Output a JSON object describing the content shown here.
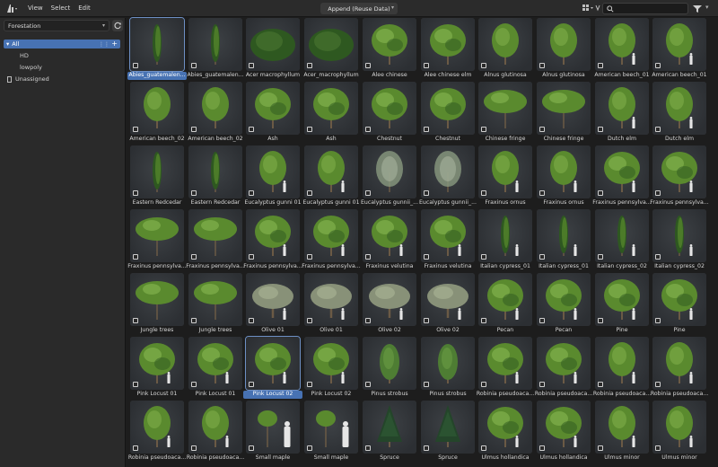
{
  "header": {
    "menus": [
      "View",
      "Select",
      "Edit"
    ],
    "import_method": "Append (Reuse Data)"
  },
  "sidebar": {
    "library": "Forestation",
    "categories": {
      "all": "All",
      "children": [
        "HD",
        "lowpoly"
      ],
      "unassigned": "Unassigned"
    }
  },
  "colors": {
    "accent": "#4772b3",
    "tile_bg": "#2f3235",
    "foliage": "#5a8a2e",
    "foliage_dark": "#2e5820"
  },
  "assets": [
    {
      "name": "Abies_guatemalen...",
      "shape": "columnar",
      "selected": true
    },
    {
      "name": "Abies_guatemalen...",
      "shape": "columnar"
    },
    {
      "name": "Acer macrophyllum",
      "shape": "bush"
    },
    {
      "name": "Acer_macrophyllum",
      "shape": "bush"
    },
    {
      "name": "Alee chinese",
      "shape": "round"
    },
    {
      "name": "Alee chinese elm",
      "shape": "round"
    },
    {
      "name": "Alnus glutinosa",
      "shape": "oval"
    },
    {
      "name": "Alnus glutinosa",
      "shape": "oval"
    },
    {
      "name": "American beech_01",
      "shape": "oval",
      "person": true
    },
    {
      "name": "American beech_01",
      "shape": "oval",
      "person": true
    },
    {
      "name": "American beech_02",
      "shape": "oval"
    },
    {
      "name": "American beech_02",
      "shape": "oval"
    },
    {
      "name": "Ash",
      "shape": "round"
    },
    {
      "name": "Ash",
      "shape": "round"
    },
    {
      "name": "Chestnut",
      "shape": "round"
    },
    {
      "name": "Chestnut",
      "shape": "round"
    },
    {
      "name": "Chinese fringe",
      "shape": "spread"
    },
    {
      "name": "Chinese fringe",
      "shape": "spread"
    },
    {
      "name": "Dutch elm",
      "shape": "oval",
      "person": true
    },
    {
      "name": "Dutch elm",
      "shape": "oval",
      "person": true
    },
    {
      "name": "Eastern Redcedar",
      "shape": "columnar"
    },
    {
      "name": "Eastern Redcedar",
      "shape": "columnar"
    },
    {
      "name": "Eucalyptus gunni 01",
      "shape": "oval",
      "person": true
    },
    {
      "name": "Eucalyptus gunni 01",
      "shape": "oval",
      "person": true
    },
    {
      "name": "Eucalyptus gunnii_...",
      "shape": "sparse"
    },
    {
      "name": "Eucalyptus gunnii_...",
      "shape": "sparse"
    },
    {
      "name": "Fraxinus ornus",
      "shape": "oval",
      "person": true
    },
    {
      "name": "Fraxinus ornus",
      "shape": "oval",
      "person": true
    },
    {
      "name": "Fraxinus pennsylva...",
      "shape": "round",
      "person": true
    },
    {
      "name": "Fraxinus pennsylva...",
      "shape": "round",
      "person": true
    },
    {
      "name": "Fraxinus pennsylva...",
      "shape": "spread"
    },
    {
      "name": "Fraxinus pennsylva...",
      "shape": "spread"
    },
    {
      "name": "Fraxinus pennsylva...",
      "shape": "round",
      "person": true
    },
    {
      "name": "Fraxinus pennsylva...",
      "shape": "round",
      "person": true
    },
    {
      "name": "Fraxinus velutina",
      "shape": "round",
      "person": true
    },
    {
      "name": "Fraxinus velutina",
      "shape": "round",
      "person": true
    },
    {
      "name": "Italian cypress_01",
      "shape": "columnar",
      "person": true
    },
    {
      "name": "Italian cypress_01",
      "shape": "columnar",
      "person": true
    },
    {
      "name": "Italian cypress_02",
      "shape": "columnar",
      "person": true
    },
    {
      "name": "Italian cypress_02",
      "shape": "columnar",
      "person": true
    },
    {
      "name": "Jungle trees",
      "shape": "spread"
    },
    {
      "name": "Jungle trees",
      "shape": "spread"
    },
    {
      "name": "Olive 01",
      "shape": "olive",
      "person": true
    },
    {
      "name": "Olive 01",
      "shape": "olive",
      "person": true
    },
    {
      "name": "Olive 02",
      "shape": "olive",
      "person": true
    },
    {
      "name": "Olive 02",
      "shape": "olive",
      "person": true
    },
    {
      "name": "Pecan",
      "shape": "round",
      "person": true
    },
    {
      "name": "Pecan",
      "shape": "round",
      "person": true
    },
    {
      "name": "Pine",
      "shape": "round",
      "person": true
    },
    {
      "name": "Pine",
      "shape": "round",
      "person": true
    },
    {
      "name": "Pink Locust 01",
      "shape": "round",
      "person": true
    },
    {
      "name": "Pink Locust 01",
      "shape": "round",
      "person": true
    },
    {
      "name": "Pink Locust 02",
      "shape": "round",
      "person": true,
      "selected": true
    },
    {
      "name": "Pink Locust 02",
      "shape": "round",
      "person": true
    },
    {
      "name": "Pinus strobus",
      "shape": "cone"
    },
    {
      "name": "Pinus strobus",
      "shape": "cone"
    },
    {
      "name": "Robinia pseudoaca...",
      "shape": "round",
      "person": true
    },
    {
      "name": "Robinia pseudoaca...",
      "shape": "round",
      "person": true
    },
    {
      "name": "Robinia pseudoaca...",
      "shape": "oval",
      "person": true
    },
    {
      "name": "Robinia pseudoaca...",
      "shape": "oval",
      "person": true
    },
    {
      "name": "Robinia pseudoaca...",
      "shape": "oval",
      "person": true
    },
    {
      "name": "Robinia pseudoaca...",
      "shape": "oval",
      "person": true
    },
    {
      "name": "Small maple",
      "shape": "small",
      "big_person": true
    },
    {
      "name": "Small maple",
      "shape": "small",
      "big_person": true
    },
    {
      "name": "Spruce",
      "shape": "spruce"
    },
    {
      "name": "Spruce",
      "shape": "spruce"
    },
    {
      "name": "Ulmus hollandica",
      "shape": "round",
      "person": true
    },
    {
      "name": "Ulmus hollandica",
      "shape": "round",
      "person": true
    },
    {
      "name": "Ulmus minor",
      "shape": "oval",
      "person": true
    },
    {
      "name": "Ulmus minor",
      "shape": "oval",
      "person": true
    }
  ]
}
